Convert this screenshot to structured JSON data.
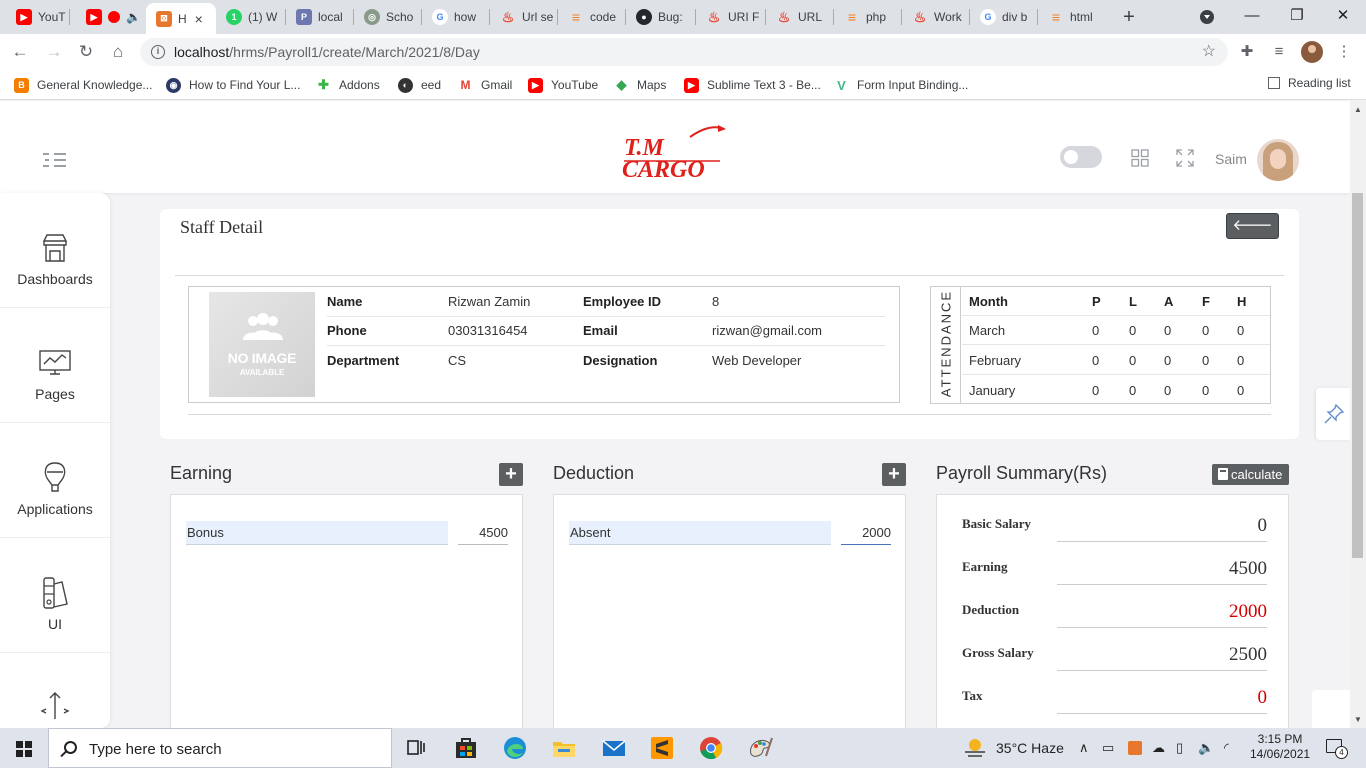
{
  "browser": {
    "tabs": [
      {
        "label": "YouT",
        "color": "#ff0000",
        "glyph": "▶"
      },
      {
        "label": "",
        "color": "#ff0000",
        "glyph": "▶"
      },
      {
        "label": "H",
        "color": "#e8772e",
        "glyph": "⊠",
        "active": true
      },
      {
        "label": "(1) W",
        "color": "#25d366",
        "glyph": "1"
      },
      {
        "label": "local",
        "color": "#6c78af",
        "glyph": "P"
      },
      {
        "label": "Scho",
        "color": "#8a9a8a",
        "glyph": "◎"
      },
      {
        "label": "how",
        "color": "#4285f4",
        "glyph": "G"
      },
      {
        "label": "Url se",
        "color": "#e8503a",
        "glyph": "♨"
      },
      {
        "label": "code",
        "color": "#f48024",
        "glyph": "≡"
      },
      {
        "label": "Bug:",
        "color": "#24292e",
        "glyph": "●"
      },
      {
        "label": "URI F",
        "color": "#e8503a",
        "glyph": "♨"
      },
      {
        "label": "URL",
        "color": "#e8503a",
        "glyph": "♨"
      },
      {
        "label": "php",
        "color": "#f48024",
        "glyph": "≡"
      },
      {
        "label": "Work",
        "color": "#e8503a",
        "glyph": "♨"
      },
      {
        "label": "div b",
        "color": "#4285f4",
        "glyph": "G"
      },
      {
        "label": "html",
        "color": "#f48024",
        "glyph": "≡"
      }
    ],
    "close_glyph": "×",
    "newtab": "+",
    "url_host": "localhost",
    "url_path": "/hrms/Payroll1/create/March/2021/8/Day",
    "bookmarks": [
      {
        "label": "General Knowledge...",
        "color": "#f57d00",
        "glyph": "B"
      },
      {
        "label": "How to Find Your L...",
        "color": "#2b3a67",
        "glyph": "◉"
      },
      {
        "label": "Addons",
        "color": "#3ab54a",
        "glyph": "✚"
      },
      {
        "label": "eed",
        "color": "#333333",
        "glyph": "◐"
      },
      {
        "label": "Gmail",
        "color": "#ea4335",
        "glyph": "M"
      },
      {
        "label": "YouTube",
        "color": "#ff0000",
        "glyph": "▶"
      },
      {
        "label": "Maps",
        "color": "#34a853",
        "glyph": "◆"
      },
      {
        "label": "Sublime Text 3 - Be...",
        "color": "#ff0000",
        "glyph": "▶"
      },
      {
        "label": "Form Input Binding...",
        "color": "#41b883",
        "glyph": "V"
      }
    ],
    "reading_list": "Reading list"
  },
  "header": {
    "logo_line1": "T.M",
    "logo_line2": "CARGO",
    "username": "Saim",
    "brand_color": "#e0201b"
  },
  "sidebar": {
    "items": [
      {
        "label": "Dashboards"
      },
      {
        "label": "Pages"
      },
      {
        "label": "Applications"
      },
      {
        "label": "UI"
      }
    ]
  },
  "staff": {
    "title": "Staff Detail",
    "back_label": "🡐",
    "noimage_line1": "NO IMAGE",
    "noimage_line2": "AVAILABLE",
    "name_label": "Name",
    "name": "Rizwan Zamin",
    "empid_label": "Employee ID",
    "empid": "8",
    "phone_label": "Phone",
    "phone": "03031316454",
    "email_label": "Email",
    "email": "rizwan@gmail.com",
    "dept_label": "Department",
    "dept": "CS",
    "desig_label": "Designation",
    "desig": "Web Developer"
  },
  "attendance": {
    "vertical_label": "ATTENDANCE",
    "headers": [
      "Month",
      "P",
      "L",
      "A",
      "F",
      "H"
    ],
    "rows": [
      {
        "month": "March",
        "p": "0",
        "l": "0",
        "a": "0",
        "f": "0",
        "h": "0"
      },
      {
        "month": "February",
        "p": "0",
        "l": "0",
        "a": "0",
        "f": "0",
        "h": "0"
      },
      {
        "month": "January",
        "p": "0",
        "l": "0",
        "a": "0",
        "f": "0",
        "h": "0"
      }
    ]
  },
  "earning": {
    "title": "Earning",
    "add_label": "+",
    "items": [
      {
        "name": "Bonus",
        "amount": "4500"
      }
    ]
  },
  "deduction": {
    "title": "Deduction",
    "add_label": "+",
    "items": [
      {
        "name": "Absent",
        "amount": "2000"
      }
    ]
  },
  "summary": {
    "title": "Payroll Summary(Rs)",
    "calc_label": "calculate",
    "basic_label": "Basic Salary",
    "basic": "0",
    "earning_label": "Earning",
    "earning": "4500",
    "deduction_label": "Deduction",
    "deduction": "2000",
    "gross_label": "Gross Salary",
    "gross": "2500",
    "tax_label": "Tax",
    "tax": "0"
  },
  "taskbar": {
    "search_placeholder": "Type here to search",
    "weather": "35°C  Haze",
    "time": "3:15 PM",
    "date": "14/06/2021",
    "notif_count": "4"
  }
}
